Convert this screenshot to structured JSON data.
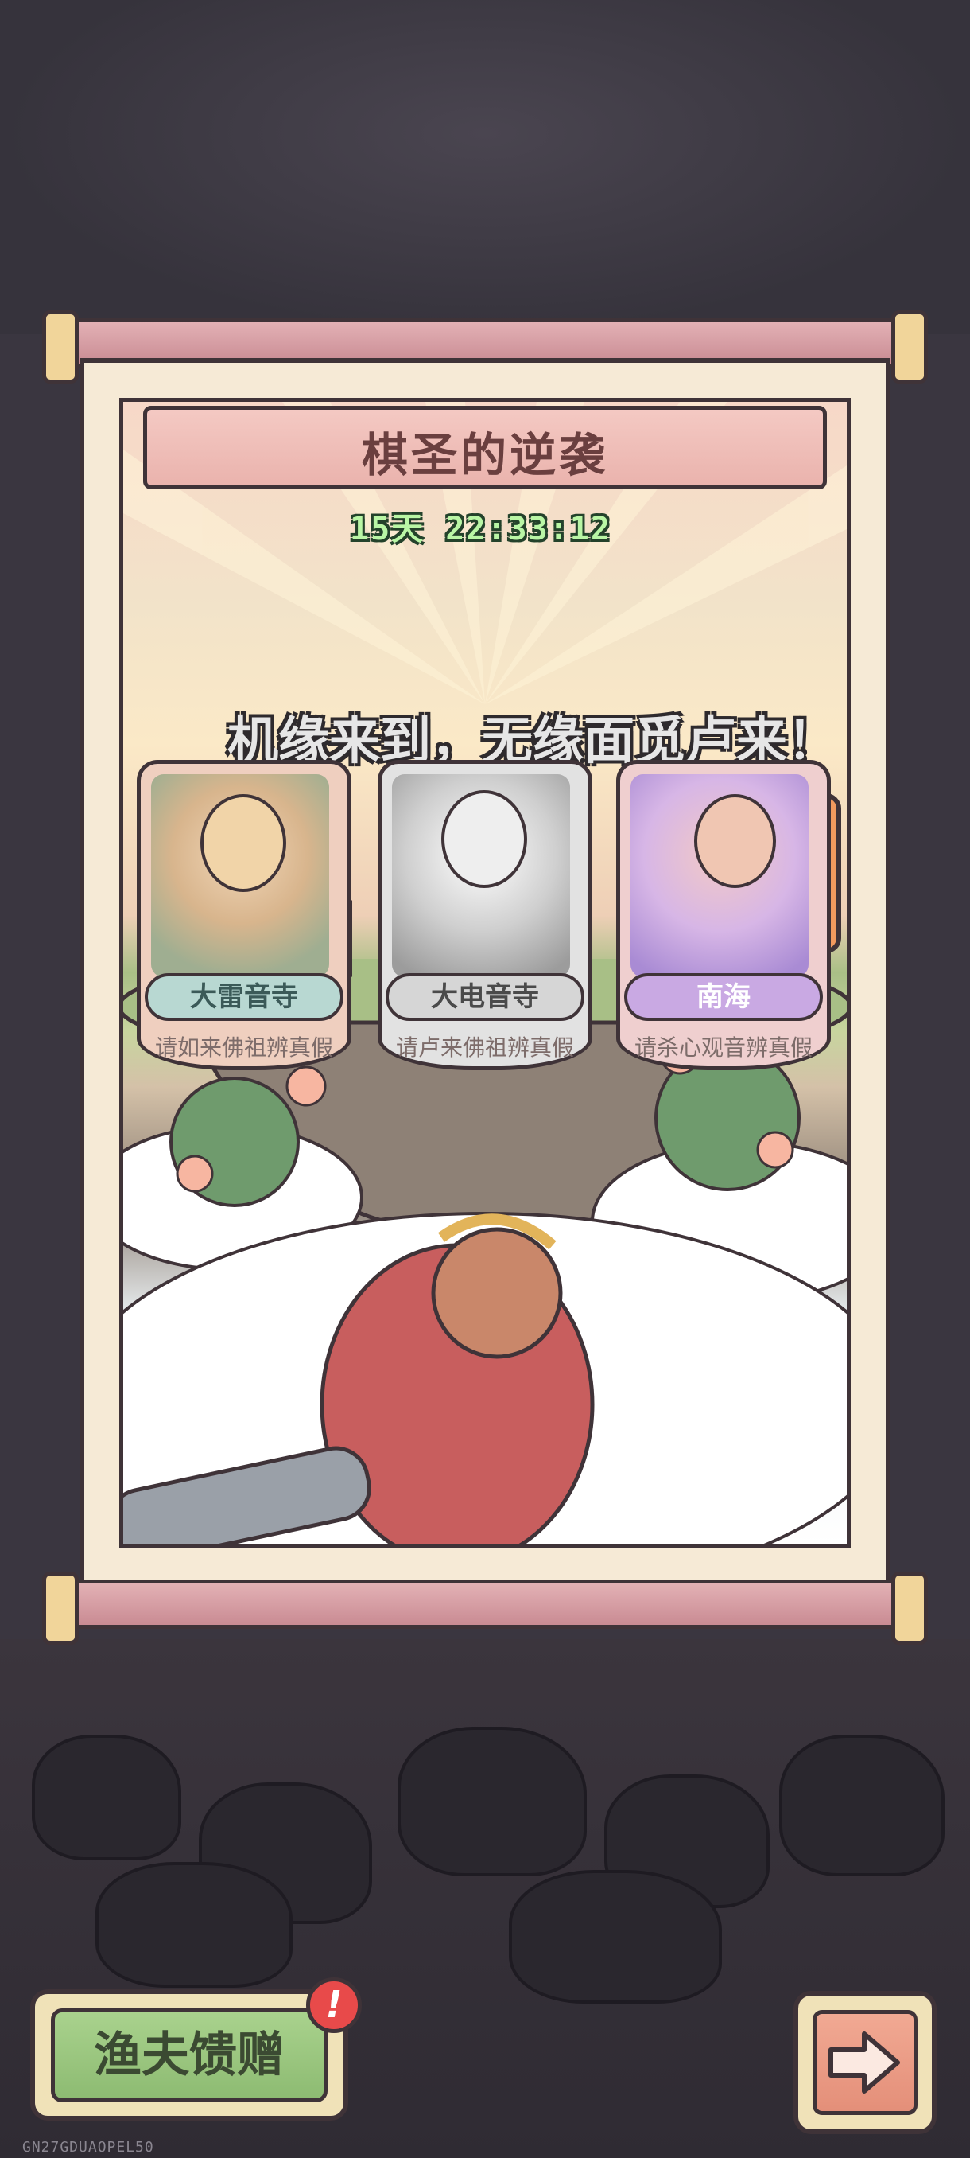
{
  "event": {
    "title": "棋圣的逆袭",
    "timer": "15天 22:33:12",
    "slogan": "机缘来到，无缘面觅卢来！"
  },
  "cards": [
    {
      "tag": "大雷音寺",
      "desc": "请如来佛祖辨真假",
      "color": "#b8d8d2"
    },
    {
      "tag": "大电音寺",
      "desc": "请卢来佛祖辨真假",
      "color": "#d6d6d6"
    },
    {
      "tag": "南海",
      "desc": "请杀心观音辨真假",
      "color": "#c9a9e3"
    }
  ],
  "buttons": {
    "gift_label": "渔夫馈赠",
    "gift_badge": "!",
    "next_icon": "right-arrow-icon"
  },
  "footer": {
    "watermark": "GN27GDUAOPEL50"
  }
}
